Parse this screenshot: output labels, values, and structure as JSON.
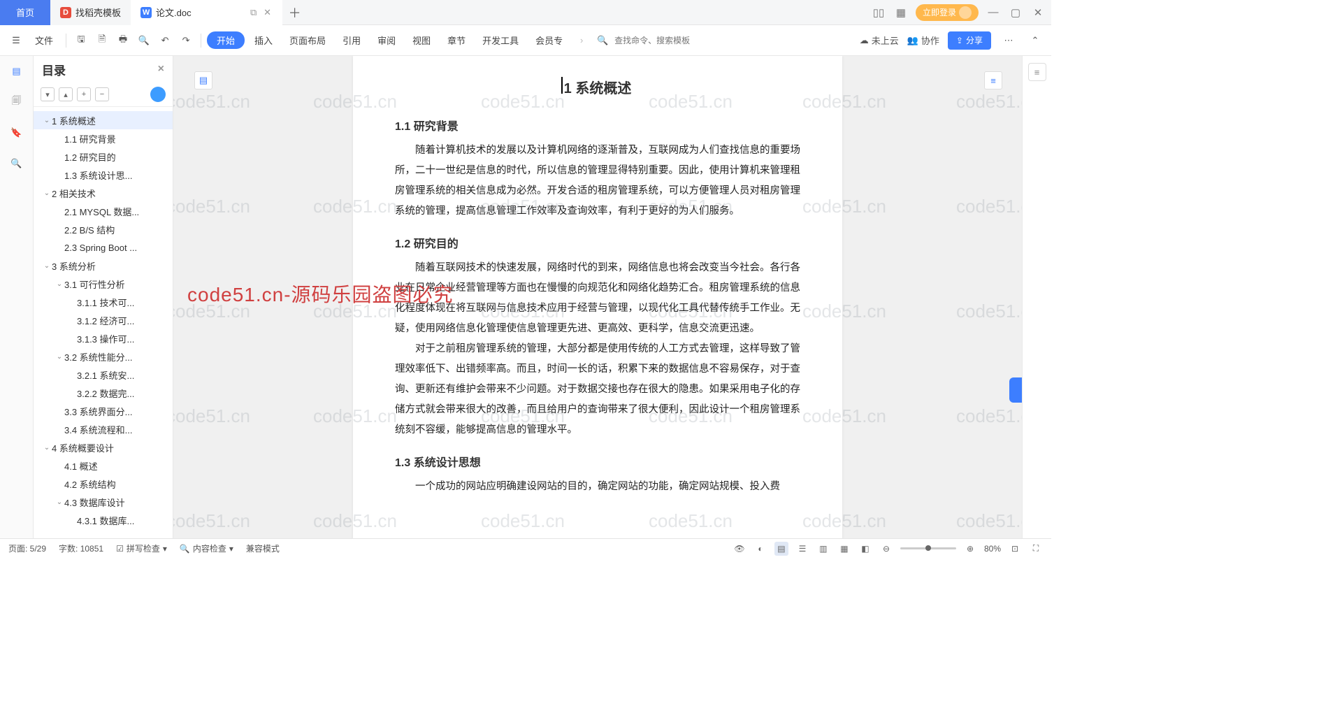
{
  "titlebar": {
    "home": "首页",
    "tab1": "找稻壳模板",
    "tab2": "论文.doc",
    "login": "立即登录"
  },
  "menu": {
    "file": "文件",
    "items": [
      "开始",
      "插入",
      "页面布局",
      "引用",
      "审阅",
      "视图",
      "章节",
      "开发工具",
      "会员专"
    ],
    "search_placeholder": "查找命令、搜索模板",
    "cloud": "未上云",
    "collab": "协作",
    "share": "分享"
  },
  "outline": {
    "title": "目录",
    "items": [
      {
        "level": 0,
        "label": "1 系统概述",
        "caret": true,
        "active": true
      },
      {
        "level": 1,
        "label": "1.1 研究背景"
      },
      {
        "level": 1,
        "label": "1.2 研究目的"
      },
      {
        "level": 1,
        "label": "1.3 系统设计思..."
      },
      {
        "level": 0,
        "label": "2 相关技术",
        "caret": true
      },
      {
        "level": 1,
        "label": "2.1 MYSQL 数据..."
      },
      {
        "level": 1,
        "label": "2.2 B/S 结构"
      },
      {
        "level": 1,
        "label": "2.3 Spring Boot ..."
      },
      {
        "level": 0,
        "label": "3 系统分析",
        "caret": true
      },
      {
        "level": 1,
        "label": "3.1 可行性分析",
        "caret": true
      },
      {
        "level": 2,
        "label": "3.1.1 技术可..."
      },
      {
        "level": 2,
        "label": "3.1.2 经济可..."
      },
      {
        "level": 2,
        "label": "3.1.3 操作可..."
      },
      {
        "level": 1,
        "label": "3.2 系统性能分...",
        "caret": true
      },
      {
        "level": 2,
        "label": "3.2.1 系统安..."
      },
      {
        "level": 2,
        "label": "3.2.2 数据完..."
      },
      {
        "level": 1,
        "label": "3.3 系统界面分..."
      },
      {
        "level": 1,
        "label": "3.4 系统流程和..."
      },
      {
        "level": 0,
        "label": "4 系统概要设计",
        "caret": true
      },
      {
        "level": 1,
        "label": "4.1 概述"
      },
      {
        "level": 1,
        "label": "4.2 系统结构"
      },
      {
        "level": 1,
        "label": "4.3 数据库设计",
        "caret": true
      },
      {
        "level": 2,
        "label": "4.3.1 数据库..."
      }
    ]
  },
  "doc": {
    "h1": "1 系统概述",
    "s11_title": "1.1  研究背景",
    "s11_body": "随着计算机技术的发展以及计算机网络的逐渐普及，互联网成为人们查找信息的重要场所，二十一世纪是信息的时代，所以信息的管理显得特别重要。因此，使用计算机来管理租房管理系统的相关信息成为必然。开发合适的租房管理系统，可以方便管理人员对租房管理系统的管理，提高信息管理工作效率及查询效率，有利于更好的为人们服务。",
    "s12_title": "1.2  研究目的",
    "s12_p1": "随着互联网技术的快速发展，网络时代的到来，网络信息也将会改变当今社会。各行各业在日常企业经营管理等方面也在慢慢的向规范化和网络化趋势汇合。租房管理系统的信息化程度体现在将互联网与信息技术应用于经营与管理，以现代化工具代替传统手工作业。无疑，使用网络信息化管理使信息管理更先进、更高效、更科学，信息交流更迅速。",
    "s12_p2": "对于之前租房管理系统的管理，大部分都是使用传统的人工方式去管理，这样导致了管理效率低下、出错频率高。而且，时间一长的话，积累下来的数据信息不容易保存，对于查询、更新还有维护会带来不少问题。对于数据交接也存在很大的隐患。如果采用电子化的存储方式就会带来很大的改善，而且给用户的查询带来了很大便利，因此设计一个租房管理系统刻不容缓，能够提高信息的管理水平。",
    "s13_title": "1.3  系统设计思想",
    "s13_p1": "一个成功的网站应明确建设网站的目的，确定网站的功能，确定网站规模、投入费",
    "watermark_main": "code51.cn-源码乐园盗图必究",
    "watermark_small": "code51.cn"
  },
  "status": {
    "page": "页面: 5/29",
    "words": "字数: 10851",
    "spell": "拼写检查",
    "content": "内容检查",
    "compat": "兼容模式",
    "zoom": "80%"
  }
}
